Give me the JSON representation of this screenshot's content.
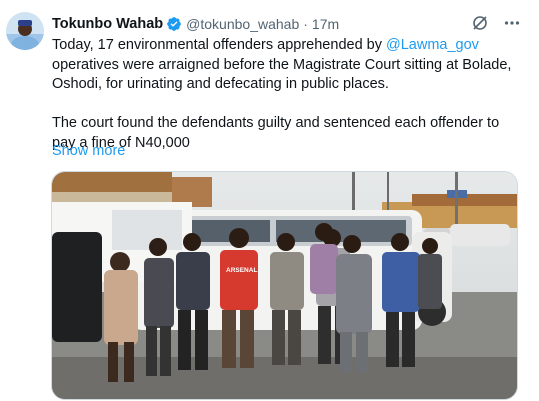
{
  "post": {
    "author": {
      "display_name": "Tokunbo Wahab",
      "handle": "@tokunbo_wahab",
      "verified": true,
      "verified_badge_color": "#1d9bf0"
    },
    "separator": "·",
    "timestamp": "17m",
    "text": {
      "line1_before_mention": "Today, 17 environmental offenders apprehended by ",
      "mention": "@Lawma_gov",
      "line1_after_mention": " operatives were arraigned before the Magistrate Court sitting at Bolade, Oshodi, for urinating and defecating in public places.",
      "paragraph2": "The court found the defendants guilty and sentenced each offender to pay a fine of N40,000"
    },
    "show_more": "Show more",
    "shirt_label": "ARSENAL",
    "icons": {
      "grok": "grok-icon",
      "more": "more-icon",
      "verified": "verified-badge-icon"
    },
    "colors": {
      "link": "#1d9bf0",
      "secondary_text": "#536471",
      "primary_text": "#0f1419"
    }
  }
}
